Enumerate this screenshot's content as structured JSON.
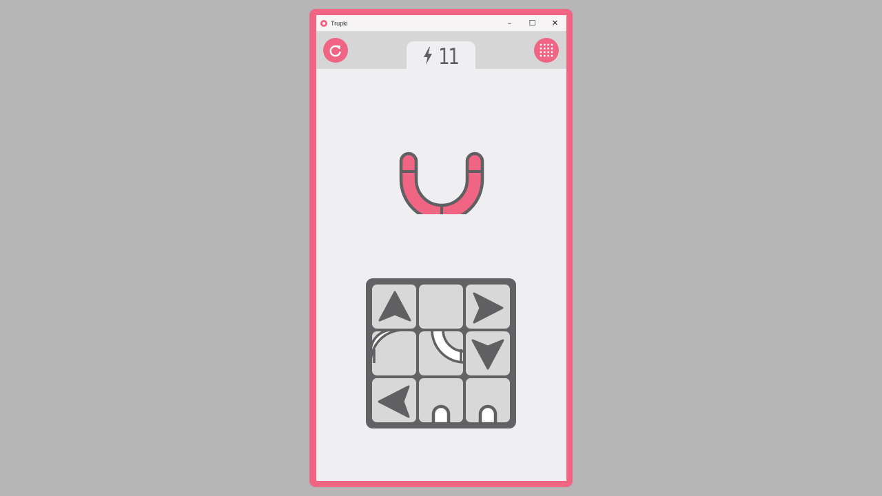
{
  "window": {
    "title": "Trupki"
  },
  "controls": {
    "minimize": "–",
    "maximize": "☐",
    "close": "✕"
  },
  "header": {
    "restart_icon": "restart-icon",
    "menu_icon": "grid-menu-icon",
    "moves": "11",
    "moves_icon": "lightning-icon"
  },
  "colors": {
    "accent": "#f06584",
    "tile": "#d8d8d9",
    "board": "#626163",
    "shape_dark": "#606062",
    "pipe_empty": "#ffffff"
  },
  "target": {
    "shape": "u-pipe",
    "segments": 4
  },
  "board": {
    "rows": 3,
    "cols": 3,
    "tiles": [
      [
        "arrow-up",
        "empty",
        "arrow-right"
      ],
      [
        "curve-left",
        "curve-right",
        "arrow-down"
      ],
      [
        "arrow-left",
        "end-cap",
        "end-cap"
      ]
    ]
  }
}
